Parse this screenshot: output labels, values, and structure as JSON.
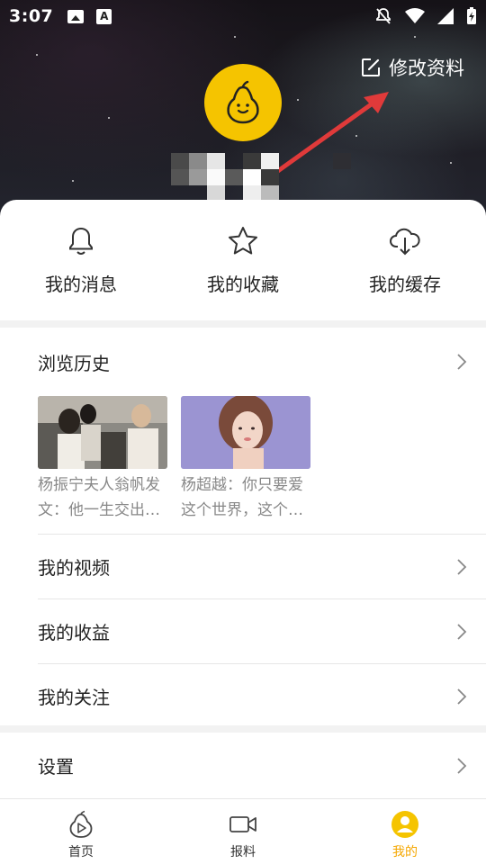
{
  "status_bar": {
    "time": "3:07"
  },
  "header": {
    "edit_profile_label": "修改资料"
  },
  "quick_actions": [
    {
      "label": "我的消息",
      "icon": "bell-icon"
    },
    {
      "label": "我的收藏",
      "icon": "star-icon"
    },
    {
      "label": "我的缓存",
      "icon": "cloud-download-icon"
    }
  ],
  "history": {
    "title": "浏览历史",
    "items": [
      {
        "title": "杨振宁夫人翁帆发文：他一生交出…"
      },
      {
        "title": "杨超越：你只要爱这个世界，这个…"
      }
    ]
  },
  "menu": [
    {
      "label": "我的视频"
    },
    {
      "label": "我的收益"
    },
    {
      "label": "我的关注"
    }
  ],
  "settings": {
    "label": "设置"
  },
  "bottom_nav": [
    {
      "label": "首页",
      "icon": "home-play-icon",
      "active": false
    },
    {
      "label": "报料",
      "icon": "video-camera-icon",
      "active": false
    },
    {
      "label": "我的",
      "icon": "user-icon",
      "active": true
    }
  ],
  "colors": {
    "accent": "#f5c400",
    "active_tab": "#f5a700",
    "annotation_arrow": "#e03a3a"
  }
}
